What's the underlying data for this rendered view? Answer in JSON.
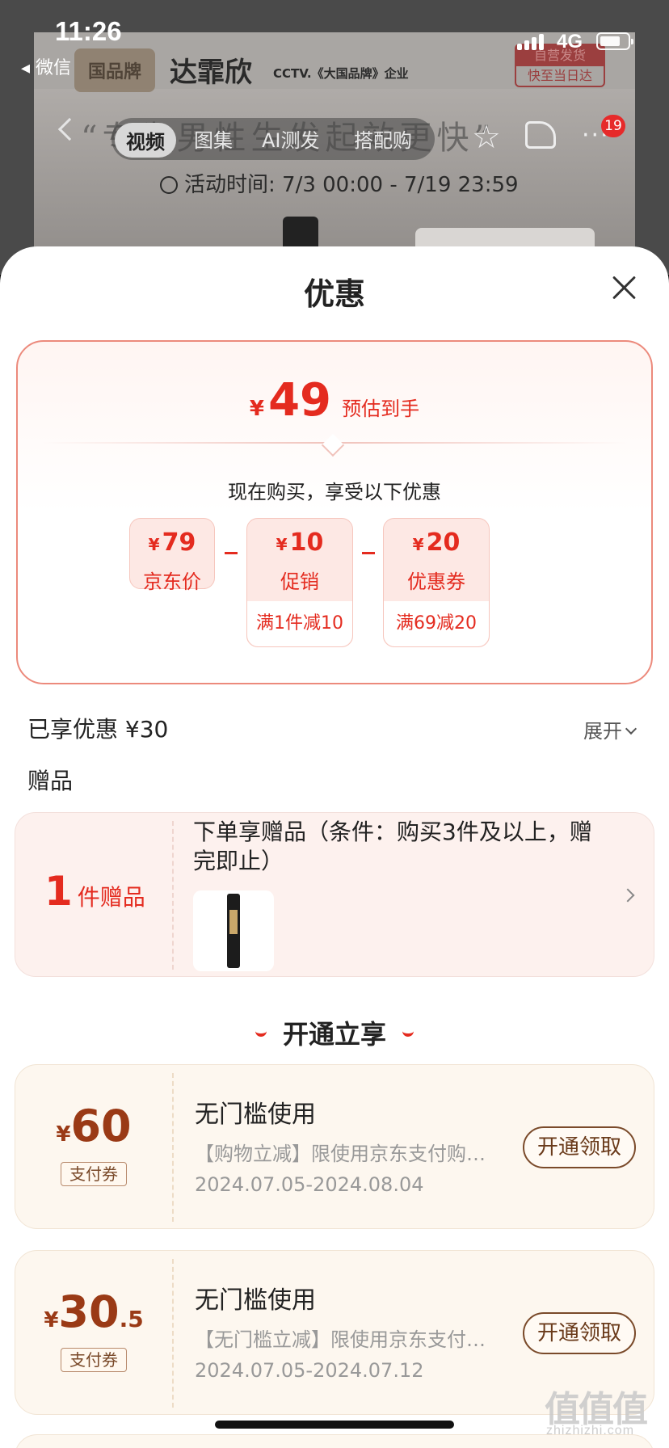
{
  "status_bar": {
    "time": "11:26",
    "back_app": "◂ 微信",
    "network": "4G"
  },
  "background": {
    "brand_logo": "国品牌",
    "brand_name": "达霏欣",
    "cctv_text": "CCTV.《大国品牌》企业",
    "shipping_line1": "自营发货",
    "shipping_line2": "快至当日达",
    "slogan": "“专为男性生发起效更快”",
    "activity_time": "活动时间: 7/3 00:00 - 7/19 23:59",
    "media_tabs": [
      "视频",
      "图集",
      "AI测发",
      "搭配购"
    ],
    "active_tab": "视频",
    "message_badge": "19"
  },
  "sheet": {
    "title": "优惠",
    "estimate": {
      "currency": "¥",
      "amount": "49",
      "label": "预估到手"
    },
    "enjoy_text": "现在购买，享受以下优惠",
    "price_boxes": [
      {
        "currency": "¥",
        "value": "79",
        "name": "京东价",
        "condition": ""
      },
      {
        "currency": "¥",
        "value": "10",
        "name": "促销",
        "condition": "满1件减10"
      },
      {
        "currency": "¥",
        "value": "20",
        "name": "优惠券",
        "condition": "满69减20"
      }
    ],
    "saved_text": "已享优惠 ¥30",
    "expand_label": "展开",
    "gift_heading": "赠品",
    "gift": {
      "count": "1",
      "unit": "件赠品",
      "description": "下单享赠品（条件：购买3件及以上，赠完即止）"
    },
    "open_heading": "开通立享",
    "coupons": [
      {
        "currency": "¥",
        "amount": "60",
        "decimal": "",
        "tag": "支付券",
        "title": "无门槛使用",
        "subtitle": "【购物立减】限使用京东支付购…",
        "date": "2024.07.05-2024.08.04",
        "button": "开通领取"
      },
      {
        "currency": "¥",
        "amount": "30",
        "decimal": ".5",
        "tag": "支付券",
        "title": "无门槛使用",
        "subtitle": "【无门槛立减】限使用京东支付…",
        "date": "2024.07.05-2024.07.12",
        "button": "开通领取"
      }
    ]
  },
  "watermark": {
    "text": "值值值",
    "url": "zhizhizhi.com"
  },
  "colors": {
    "accent": "#e42b1f",
    "coupon_brown": "#9a3a16",
    "sheet_bg": "#ffffff"
  }
}
